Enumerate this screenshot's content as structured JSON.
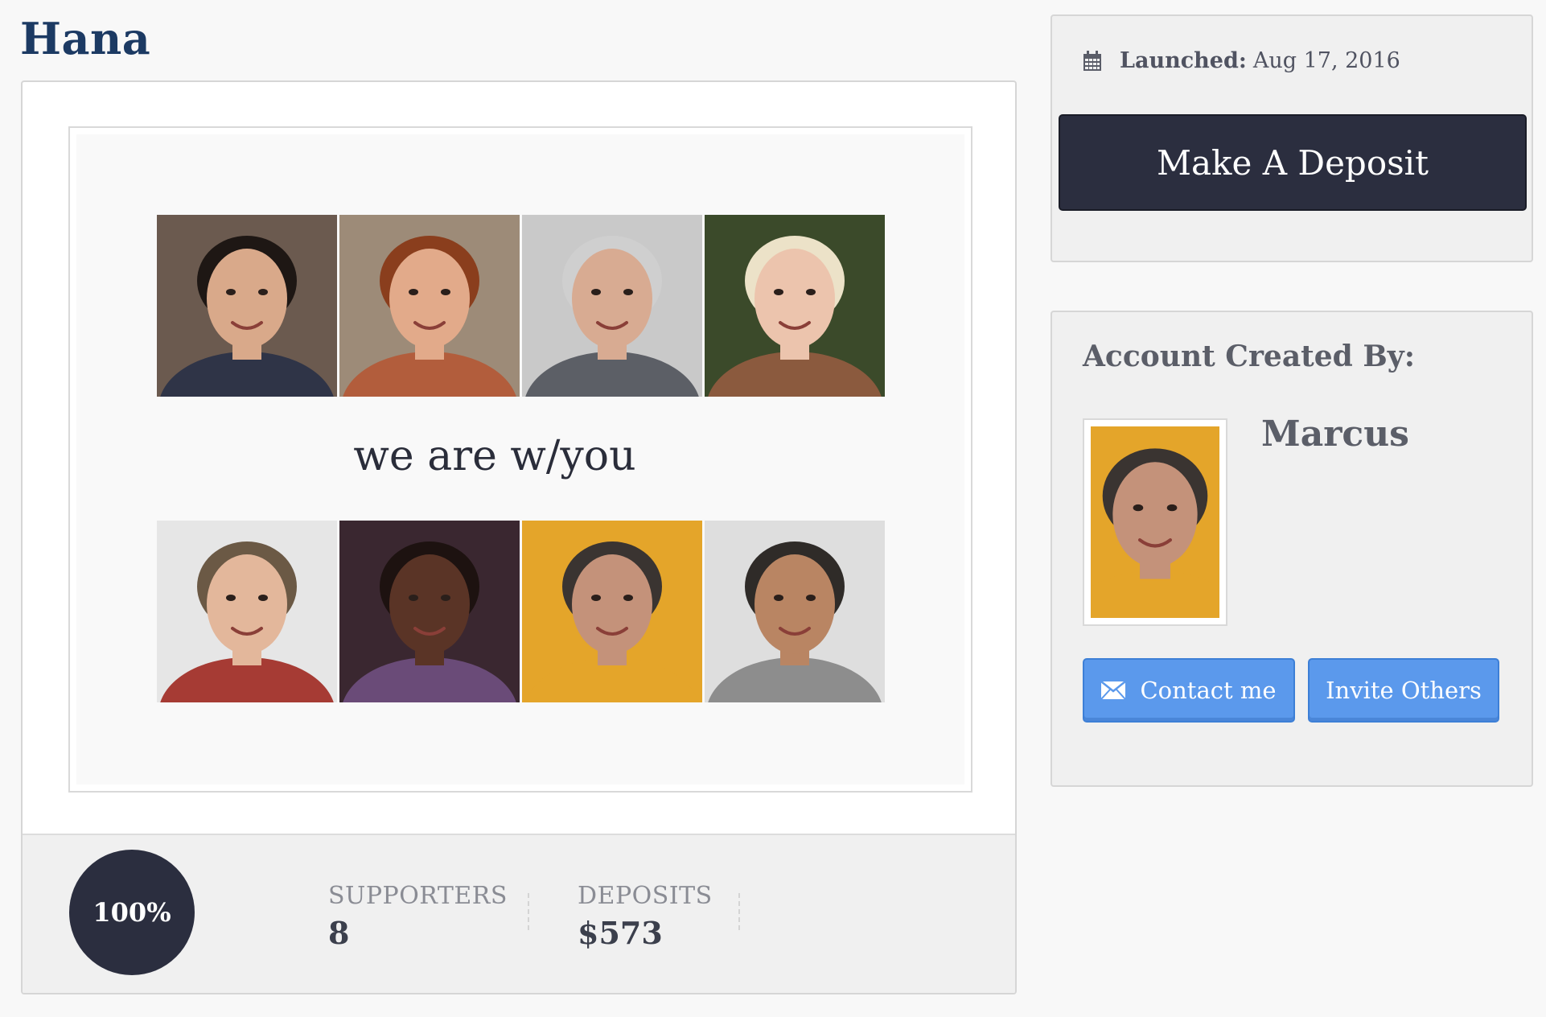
{
  "page": {
    "title": "Hana"
  },
  "banner": {
    "caption": "we are w/you",
    "photos_top": [
      {
        "icon": "portrait-woman-dark-hair",
        "bg": "#6b5a4f",
        "skin": "#d9a98a",
        "hair": "#1e1714",
        "shirt": "#2f3447"
      },
      {
        "icon": "portrait-woman-auburn-hair",
        "bg": "#9d8b78",
        "skin": "#e2aa8a",
        "hair": "#8a3e1d",
        "shirt": "#b25d3c"
      },
      {
        "icon": "portrait-man-gray-hair",
        "bg": "#c9c9c9",
        "skin": "#d8ab92",
        "hair": "#cfcfcf",
        "shirt": "#5c5f66"
      },
      {
        "icon": "portrait-woman-blonde-hair",
        "bg": "#3b4a2a",
        "skin": "#ecc4ad",
        "hair": "#ece2c8",
        "shirt": "#8b5a3e"
      }
    ],
    "photos_bottom": [
      {
        "icon": "portrait-man-brown-hair",
        "bg": "#e6e6e6",
        "skin": "#e3b79b",
        "hair": "#6b5945",
        "shirt": "#a63b34"
      },
      {
        "icon": "portrait-woman-smiling",
        "bg": "#3a2730",
        "skin": "#5a3426",
        "hair": "#1d1210",
        "shirt": "#6a4b78"
      },
      {
        "icon": "portrait-man-yellow-sweater",
        "bg": "#e4a52a",
        "skin": "#c4927a",
        "hair": "#3a3431",
        "shirt": "#e4a52a"
      },
      {
        "icon": "portrait-man-glasses",
        "bg": "#dedede",
        "skin": "#b98563",
        "hair": "#2f2b28",
        "shirt": "#8d8d8d"
      }
    ]
  },
  "stats": {
    "progress_text": "100%",
    "progress_fraction": 1.0,
    "supporters_label": "SUPPORTERS",
    "supporters_value": "8",
    "deposits_label": "DEPOSITS",
    "deposits_value": "$573"
  },
  "launch": {
    "icon": "calendar-icon",
    "label": "Launched:",
    "date": "Aug 17, 2016",
    "deposit_button": "Make A Deposit"
  },
  "creator": {
    "heading": "Account Created By:",
    "name": "Marcus",
    "avatar_icon": "portrait-man-yellow-sweater",
    "contact_button": "Contact me",
    "contact_icon": "envelope-icon",
    "invite_button": "Invite Others"
  },
  "colors": {
    "title": "#1c3a63",
    "dark_button": "#2b2e3f",
    "blue_button": "#5b99ec",
    "panel_bg": "#f0f0f0"
  }
}
